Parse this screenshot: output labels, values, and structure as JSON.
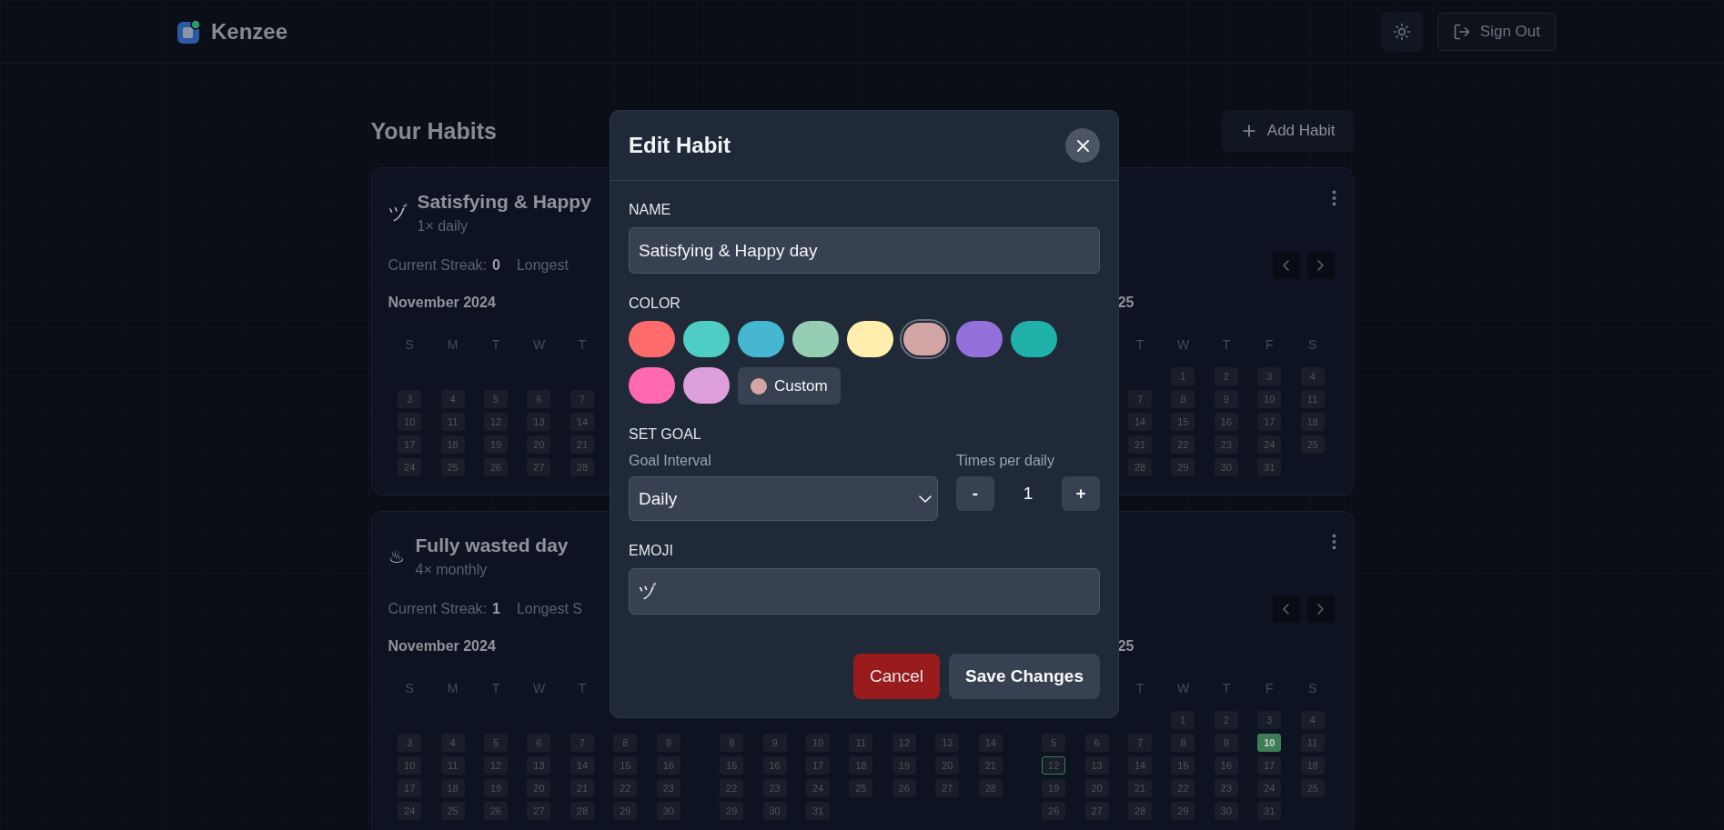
{
  "header": {
    "brand": "Kenzee",
    "sign_out": "Sign Out"
  },
  "page": {
    "title": "Your Habits",
    "add_button": "Add Habit"
  },
  "habits": [
    {
      "emoji": "ヅ",
      "name": "Satisfying & Happy",
      "frequency": "1× daily",
      "streak_label": "Current Streak:",
      "streak_value": "0",
      "longest_label": "Longest",
      "months": {
        "left": {
          "title": "November 2024",
          "clipped": false,
          "weekdays": [
            {
              "kind": "label",
              "text": "S"
            },
            {
              "kind": "label",
              "text": "M"
            },
            {
              "kind": "label",
              "text": "T"
            },
            {
              "kind": "label",
              "text": "W"
            },
            {
              "kind": "label",
              "text": "T"
            },
            {
              "kind": "blank"
            },
            {
              "kind": "blank"
            }
          ],
          "weeks": [
            [
              {
                "kind": "blank"
              },
              {
                "kind": "blank"
              },
              {
                "kind": "blank"
              },
              {
                "kind": "blank"
              },
              {
                "kind": "blank"
              },
              {
                "kind": "blank"
              },
              {
                "kind": "blank"
              }
            ],
            [
              {
                "kind": "day",
                "day": "3",
                "done": false,
                "today": false
              },
              {
                "kind": "day",
                "day": "4",
                "done": false,
                "today": false
              },
              {
                "kind": "day",
                "day": "5",
                "done": false,
                "today": false
              },
              {
                "kind": "day",
                "day": "6",
                "done": false,
                "today": false
              },
              {
                "kind": "day",
                "day": "7",
                "done": false,
                "today": false
              },
              {
                "kind": "blank"
              },
              {
                "kind": "blank"
              }
            ],
            [
              {
                "kind": "day",
                "day": "10",
                "done": false,
                "today": false
              },
              {
                "kind": "day",
                "day": "11",
                "done": false,
                "today": false
              },
              {
                "kind": "day",
                "day": "12",
                "done": false,
                "today": false
              },
              {
                "kind": "day",
                "day": "13",
                "done": false,
                "today": false
              },
              {
                "kind": "day",
                "day": "14",
                "done": false,
                "today": false
              },
              {
                "kind": "blank"
              },
              {
                "kind": "blank"
              }
            ],
            [
              {
                "kind": "day",
                "day": "17",
                "done": false,
                "today": false
              },
              {
                "kind": "day",
                "day": "18",
                "done": false,
                "today": false
              },
              {
                "kind": "day",
                "day": "19",
                "done": false,
                "today": false
              },
              {
                "kind": "day",
                "day": "20",
                "done": false,
                "today": false
              },
              {
                "kind": "day",
                "day": "21",
                "done": false,
                "today": false
              },
              {
                "kind": "blank"
              },
              {
                "kind": "blank"
              }
            ],
            [
              {
                "kind": "day",
                "day": "24",
                "done": false,
                "today": false
              },
              {
                "kind": "day",
                "day": "25",
                "done": false,
                "today": false
              },
              {
                "kind": "day",
                "day": "26",
                "done": false,
                "today": false
              },
              {
                "kind": "day",
                "day": "27",
                "done": false,
                "today": false
              },
              {
                "kind": "day",
                "day": "28",
                "done": false,
                "today": false
              },
              {
                "kind": "blank"
              },
              {
                "kind": "blank"
              }
            ]
          ]
        },
        "right": {
          "title": "25",
          "clipped": true,
          "weekdays": [
            {
              "kind": "blank"
            },
            {
              "kind": "blank"
            },
            {
              "kind": "label",
              "text": "T"
            },
            {
              "kind": "label",
              "text": "W"
            },
            {
              "kind": "label",
              "text": "T"
            },
            {
              "kind": "label",
              "text": "F"
            },
            {
              "kind": "label",
              "text": "S"
            }
          ],
          "weeks": [
            [
              {
                "kind": "blank"
              },
              {
                "kind": "blank"
              },
              {
                "kind": "blank"
              },
              {
                "kind": "day",
                "day": "1",
                "done": false,
                "today": false
              },
              {
                "kind": "day",
                "day": "2",
                "done": false,
                "today": false
              },
              {
                "kind": "day",
                "day": "3",
                "done": false,
                "today": false
              },
              {
                "kind": "day",
                "day": "4",
                "done": false,
                "today": false
              }
            ],
            [
              {
                "kind": "blank"
              },
              {
                "kind": "blank"
              },
              {
                "kind": "day",
                "day": "7",
                "done": false,
                "today": false
              },
              {
                "kind": "day",
                "day": "8",
                "done": false,
                "today": false
              },
              {
                "kind": "day",
                "day": "9",
                "done": false,
                "today": false
              },
              {
                "kind": "day",
                "day": "10",
                "done": false,
                "today": false
              },
              {
                "kind": "day",
                "day": "11",
                "done": false,
                "today": false
              }
            ],
            [
              {
                "kind": "blank"
              },
              {
                "kind": "blank"
              },
              {
                "kind": "day",
                "day": "14",
                "done": false,
                "today": false
              },
              {
                "kind": "day",
                "day": "15",
                "done": false,
                "today": false
              },
              {
                "kind": "day",
                "day": "16",
                "done": false,
                "today": false
              },
              {
                "kind": "day",
                "day": "17",
                "done": false,
                "today": false
              },
              {
                "kind": "day",
                "day": "18",
                "done": false,
                "today": false
              }
            ],
            [
              {
                "kind": "blank"
              },
              {
                "kind": "blank"
              },
              {
                "kind": "day",
                "day": "21",
                "done": false,
                "today": false
              },
              {
                "kind": "day",
                "day": "22",
                "done": false,
                "today": false
              },
              {
                "kind": "day",
                "day": "23",
                "done": false,
                "today": false
              },
              {
                "kind": "day",
                "day": "24",
                "done": false,
                "today": false
              },
              {
                "kind": "day",
                "day": "25",
                "done": false,
                "today": false
              }
            ],
            [
              {
                "kind": "blank"
              },
              {
                "kind": "blank"
              },
              {
                "kind": "day",
                "day": "28",
                "done": false,
                "today": false
              },
              {
                "kind": "day",
                "day": "29",
                "done": false,
                "today": false
              },
              {
                "kind": "day",
                "day": "30",
                "done": false,
                "today": false
              },
              {
                "kind": "day",
                "day": "31",
                "done": false,
                "today": false
              },
              {
                "kind": "blank"
              }
            ]
          ]
        }
      }
    },
    {
      "emoji": "♨",
      "name": "Fully wasted day",
      "frequency": "4× monthly",
      "streak_label": "Current Streak:",
      "streak_value": "1",
      "longest_label": "Longest S",
      "months": {
        "left": {
          "title": "November 2024",
          "clipped": false,
          "weekdays": [
            {
              "kind": "label",
              "text": "S"
            },
            {
              "kind": "label",
              "text": "M"
            },
            {
              "kind": "label",
              "text": "T"
            },
            {
              "kind": "label",
              "text": "W"
            },
            {
              "kind": "label",
              "text": "T"
            },
            {
              "kind": "blank"
            },
            {
              "kind": "blank"
            }
          ],
          "weeks": [
            [
              {
                "kind": "blank"
              },
              {
                "kind": "blank"
              },
              {
                "kind": "blank"
              },
              {
                "kind": "blank"
              },
              {
                "kind": "blank"
              },
              {
                "kind": "blank"
              },
              {
                "kind": "blank"
              }
            ],
            [
              {
                "kind": "day",
                "day": "3",
                "done": false,
                "today": false
              },
              {
                "kind": "day",
                "day": "4",
                "done": false,
                "today": false
              },
              {
                "kind": "day",
                "day": "5",
                "done": false,
                "today": false
              },
              {
                "kind": "day",
                "day": "6",
                "done": false,
                "today": false
              },
              {
                "kind": "day",
                "day": "7",
                "done": false,
                "today": false
              },
              {
                "kind": "day",
                "day": "8",
                "done": false,
                "today": false
              },
              {
                "kind": "day",
                "day": "9",
                "done": false,
                "today": false
              }
            ],
            [
              {
                "kind": "day",
                "day": "10",
                "done": false,
                "today": false
              },
              {
                "kind": "day",
                "day": "11",
                "done": false,
                "today": false
              },
              {
                "kind": "day",
                "day": "12",
                "done": false,
                "today": false
              },
              {
                "kind": "day",
                "day": "13",
                "done": false,
                "today": false
              },
              {
                "kind": "day",
                "day": "14",
                "done": false,
                "today": false
              },
              {
                "kind": "day",
                "day": "15",
                "done": false,
                "today": false
              },
              {
                "kind": "day",
                "day": "16",
                "done": false,
                "today": false
              }
            ],
            [
              {
                "kind": "day",
                "day": "17",
                "done": false,
                "today": false
              },
              {
                "kind": "day",
                "day": "18",
                "done": false,
                "today": false
              },
              {
                "kind": "day",
                "day": "19",
                "done": false,
                "today": false
              },
              {
                "kind": "day",
                "day": "20",
                "done": false,
                "today": false
              },
              {
                "kind": "day",
                "day": "21",
                "done": false,
                "today": false
              },
              {
                "kind": "day",
                "day": "22",
                "done": false,
                "today": false
              },
              {
                "kind": "day",
                "day": "23",
                "done": false,
                "today": false
              }
            ],
            [
              {
                "kind": "day",
                "day": "24",
                "done": false,
                "today": false
              },
              {
                "kind": "day",
                "day": "25",
                "done": false,
                "today": false
              },
              {
                "kind": "day",
                "day": "26",
                "done": false,
                "today": false
              },
              {
                "kind": "day",
                "day": "27",
                "done": false,
                "today": false
              },
              {
                "kind": "day",
                "day": "28",
                "done": false,
                "today": false
              },
              {
                "kind": "day",
                "day": "29",
                "done": false,
                "today": false
              },
              {
                "kind": "day",
                "day": "30",
                "done": false,
                "today": false
              }
            ]
          ]
        },
        "middle": {
          "weeks": [
            [
              {
                "kind": "blank"
              },
              {
                "kind": "blank"
              },
              {
                "kind": "blank"
              },
              {
                "kind": "blank"
              },
              {
                "kind": "blank"
              },
              {
                "kind": "blank"
              },
              {
                "kind": "blank"
              }
            ],
            [
              {
                "kind": "day",
                "day": "8",
                "done": false,
                "today": false
              },
              {
                "kind": "day",
                "day": "9",
                "done": false,
                "today": false
              },
              {
                "kind": "day",
                "day": "10",
                "done": false,
                "today": false
              },
              {
                "kind": "day",
                "day": "11",
                "done": false,
                "today": false
              },
              {
                "kind": "day",
                "day": "12",
                "done": false,
                "today": false
              },
              {
                "kind": "day",
                "day": "13",
                "done": false,
                "today": false
              },
              {
                "kind": "day",
                "day": "14",
                "done": false,
                "today": false
              }
            ],
            [
              {
                "kind": "day",
                "day": "15",
                "done": false,
                "today": false
              },
              {
                "kind": "day",
                "day": "16",
                "done": false,
                "today": false
              },
              {
                "kind": "day",
                "day": "17",
                "done": false,
                "today": false
              },
              {
                "kind": "day",
                "day": "18",
                "done": false,
                "today": false
              },
              {
                "kind": "day",
                "day": "19",
                "done": false,
                "today": false
              },
              {
                "kind": "day",
                "day": "20",
                "done": false,
                "today": false
              },
              {
                "kind": "day",
                "day": "21",
                "done": false,
                "today": false
              }
            ],
            [
              {
                "kind": "day",
                "day": "22",
                "done": false,
                "today": false
              },
              {
                "kind": "day",
                "day": "23",
                "done": false,
                "today": false
              },
              {
                "kind": "day",
                "day": "24",
                "done": false,
                "today": false
              },
              {
                "kind": "day",
                "day": "25",
                "done": false,
                "today": false
              },
              {
                "kind": "day",
                "day": "26",
                "done": false,
                "today": false
              },
              {
                "kind": "day",
                "day": "27",
                "done": false,
                "today": false
              },
              {
                "kind": "day",
                "day": "28",
                "done": false,
                "today": false
              }
            ],
            [
              {
                "kind": "day",
                "day": "29",
                "done": false,
                "today": false
              },
              {
                "kind": "day",
                "day": "30",
                "done": false,
                "today": false
              },
              {
                "kind": "day",
                "day": "31",
                "done": false,
                "today": false
              },
              {
                "kind": "blank"
              },
              {
                "kind": "blank"
              },
              {
                "kind": "blank"
              },
              {
                "kind": "blank"
              }
            ]
          ]
        },
        "right": {
          "title": "25",
          "clipped": true,
          "weekdays": [
            {
              "kind": "blank"
            },
            {
              "kind": "blank"
            },
            {
              "kind": "label",
              "text": "T"
            },
            {
              "kind": "label",
              "text": "W"
            },
            {
              "kind": "label",
              "text": "T"
            },
            {
              "kind": "label",
              "text": "F"
            },
            {
              "kind": "label",
              "text": "S"
            }
          ],
          "weeks": [
            [
              {
                "kind": "blank"
              },
              {
                "kind": "blank"
              },
              {
                "kind": "blank"
              },
              {
                "kind": "day",
                "day": "1",
                "done": false,
                "today": false
              },
              {
                "kind": "day",
                "day": "2",
                "done": false,
                "today": false
              },
              {
                "kind": "day",
                "day": "3",
                "done": false,
                "today": false
              },
              {
                "kind": "day",
                "day": "4",
                "done": false,
                "today": false
              }
            ],
            [
              {
                "kind": "day",
                "day": "5",
                "done": false,
                "today": false
              },
              {
                "kind": "day",
                "day": "6",
                "done": false,
                "today": false
              },
              {
                "kind": "day",
                "day": "7",
                "done": false,
                "today": false
              },
              {
                "kind": "day",
                "day": "8",
                "done": false,
                "today": false
              },
              {
                "kind": "day",
                "day": "9",
                "done": false,
                "today": false
              },
              {
                "kind": "day",
                "day": "10",
                "done": true,
                "today": false
              },
              {
                "kind": "day",
                "day": "11",
                "done": false,
                "today": false
              }
            ],
            [
              {
                "kind": "day",
                "day": "12",
                "done": false,
                "today": true
              },
              {
                "kind": "day",
                "day": "13",
                "done": false,
                "today": false
              },
              {
                "kind": "day",
                "day": "14",
                "done": false,
                "today": false
              },
              {
                "kind": "day",
                "day": "15",
                "done": false,
                "today": false
              },
              {
                "kind": "day",
                "day": "16",
                "done": false,
                "today": false
              },
              {
                "kind": "day",
                "day": "17",
                "done": false,
                "today": false
              },
              {
                "kind": "day",
                "day": "18",
                "done": false,
                "today": false
              }
            ],
            [
              {
                "kind": "day",
                "day": "19",
                "done": false,
                "today": false
              },
              {
                "kind": "day",
                "day": "20",
                "done": false,
                "today": false
              },
              {
                "kind": "day",
                "day": "21",
                "done": false,
                "today": false
              },
              {
                "kind": "day",
                "day": "22",
                "done": false,
                "today": false
              },
              {
                "kind": "day",
                "day": "23",
                "done": false,
                "today": false
              },
              {
                "kind": "day",
                "day": "24",
                "done": false,
                "today": false
              },
              {
                "kind": "day",
                "day": "25",
                "done": false,
                "today": false
              }
            ],
            [
              {
                "kind": "day",
                "day": "26",
                "done": false,
                "today": false
              },
              {
                "kind": "day",
                "day": "27",
                "done": false,
                "today": false
              },
              {
                "kind": "day",
                "day": "28",
                "done": false,
                "today": false
              },
              {
                "kind": "day",
                "day": "29",
                "done": false,
                "today": false
              },
              {
                "kind": "day",
                "day": "30",
                "done": false,
                "today": false
              },
              {
                "kind": "day",
                "day": "31",
                "done": false,
                "today": false
              },
              {
                "kind": "blank"
              }
            ]
          ]
        }
      }
    }
  ],
  "dialog": {
    "title": "Edit Habit",
    "name_label": "NAME",
    "name_value": "Satisfying & Happy day",
    "color_label": "COLOR",
    "swatches": [
      {
        "color": "#ff6b6b",
        "selected": false
      },
      {
        "color": "#4ecdc4",
        "selected": false
      },
      {
        "color": "#45b7d1",
        "selected": false
      },
      {
        "color": "#96ceb4",
        "selected": false
      },
      {
        "color": "#ffeead",
        "selected": false
      },
      {
        "color": "#d4a5a5",
        "selected": true
      },
      {
        "color": "#9370db",
        "selected": false
      },
      {
        "color": "#20b2aa",
        "selected": false
      },
      {
        "color": "#ff69b4",
        "selected": false
      },
      {
        "color": "#dda0dd",
        "selected": false
      }
    ],
    "custom": {
      "label": "Custom",
      "color": "#d4a5a5"
    },
    "goal_label": "SET GOAL",
    "interval_label": "Goal Interval",
    "interval_value": "Daily",
    "times_label": "Times per daily",
    "decrement": "-",
    "count": "1",
    "increment": "+",
    "emoji_label": "EMOJI",
    "emoji_value": "ヅ",
    "cancel": "Cancel",
    "save": "Save Changes"
  }
}
